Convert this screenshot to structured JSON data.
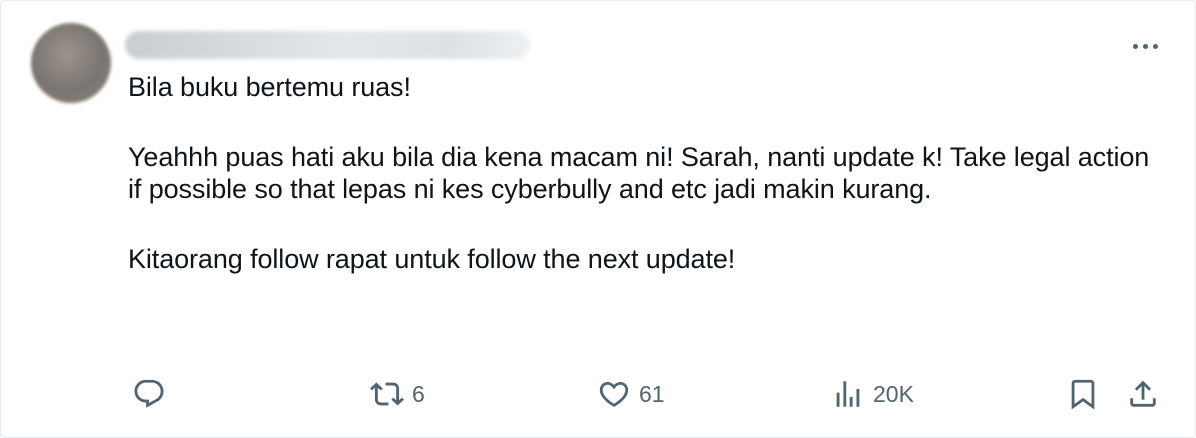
{
  "post": {
    "lines": [
      "Bila buku bertemu ruas!",
      "Yeahhh puas hati aku bila dia kena macam ni! Sarah, nanti update k! Take legal action if possible so that lepas ni kes cyberbully and etc jadi makin kurang.",
      "Kitaorang follow rapat untuk follow the next update!"
    ]
  },
  "actions": {
    "reply": {
      "icon": "reply-icon",
      "count": ""
    },
    "repost": {
      "icon": "repost-icon",
      "count": "6"
    },
    "like": {
      "icon": "heart-icon",
      "count": "61"
    },
    "views": {
      "icon": "views-icon",
      "count": "20K"
    },
    "bookmark": {
      "icon": "bookmark-icon"
    },
    "share": {
      "icon": "share-icon"
    }
  },
  "colors": {
    "text": "#0f1419",
    "muted": "#536471",
    "border": "#e6ecf0"
  }
}
